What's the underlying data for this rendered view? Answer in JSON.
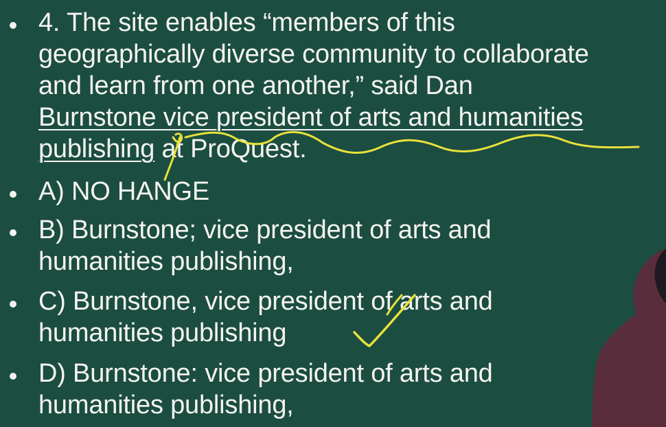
{
  "question": {
    "line1": "4. The site enables  “members of this",
    "line2": "geographically diverse community to collaborate",
    "line3": "and learn from one another,”  said Dan",
    "line4": "Burnstone vice president of arts and humanities",
    "line5_underlined": "publishing",
    "line5_rest": " at ProQuest."
  },
  "options": {
    "a": {
      "line1": "A) NO HANGE"
    },
    "b": {
      "line1": "B) Burnstone; vice president of arts and",
      "line2": "humanities publishing,"
    },
    "c": {
      "line1": "C) Burnstone, vice president of arts and",
      "line2": "humanities publishing"
    },
    "d": {
      "line1": "D) Burnstone: vice president of arts and",
      "line2": "humanities publishing,"
    }
  },
  "colors": {
    "background": "#1c4d41",
    "text": "#f4f4ef",
    "annotation": "#e8e23a",
    "presenter": "#5a2d3c"
  }
}
